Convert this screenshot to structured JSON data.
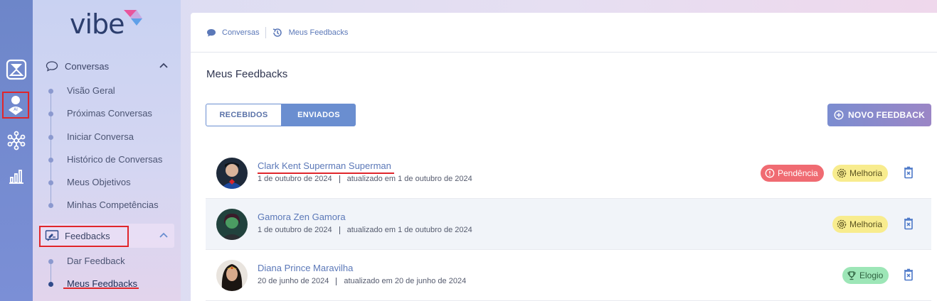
{
  "app": {
    "logo_text": "vibe"
  },
  "rail": {
    "icons": [
      "hourglass-logo-icon",
      "ai-user-icon",
      "network-icon",
      "bar-chart-icon"
    ]
  },
  "sidebar": {
    "groups": [
      {
        "label": "Conversas",
        "icon": "chat-bubble-icon",
        "items": [
          {
            "label": "Visão Geral"
          },
          {
            "label": "Próximas Conversas"
          },
          {
            "label": "Iniciar Conversa"
          },
          {
            "label": "Histórico de Conversas"
          },
          {
            "label": "Meus Objetivos"
          },
          {
            "label": "Minhas Competências"
          }
        ]
      },
      {
        "label": "Feedbacks",
        "icon": "feedback-icon",
        "items": [
          {
            "label": "Dar Feedback"
          },
          {
            "label": "Meus Feedbacks"
          }
        ]
      }
    ]
  },
  "breadcrumb": {
    "items": [
      {
        "label": "Conversas",
        "icon": "chat-bubble-icon"
      },
      {
        "label": "Meus Feedbacks",
        "icon": "history-icon"
      }
    ]
  },
  "main": {
    "title": "Meus Feedbacks",
    "tabs": [
      {
        "label": "RECEBIDOS",
        "active": false
      },
      {
        "label": "ENVIADOS",
        "active": true
      }
    ],
    "new_button_label": "NOVO FEEDBACK",
    "rows": [
      {
        "name": "Clark Kent Superman Superman",
        "date": "1 de outubro de 2024",
        "updated": "atualizado em 1 de outubro de 2024",
        "badges": [
          {
            "label": "Pendência",
            "type": "pendencia",
            "color": "#f06b72"
          },
          {
            "label": "Melhoria",
            "type": "melhoria",
            "color": "#f8ec8e"
          }
        ]
      },
      {
        "name": "Gamora Zen Gamora",
        "date": "1 de outubro de 2024",
        "updated": "atualizado em 1 de outubro de 2024",
        "badges": [
          {
            "label": "Melhoria",
            "type": "melhoria",
            "color": "#f8ec8e"
          }
        ]
      },
      {
        "name": "Diana Prince Maravilha",
        "date": "20 de junho de 2024",
        "updated": "atualizado em 20 de junho de 2024",
        "badges": [
          {
            "label": "Elogio",
            "type": "elogio",
            "color": "#9de6b7"
          }
        ]
      }
    ]
  },
  "colors": {
    "accent": "#6a8ed0",
    "link": "#5b78b8",
    "highlight_red": "#e0262b"
  }
}
